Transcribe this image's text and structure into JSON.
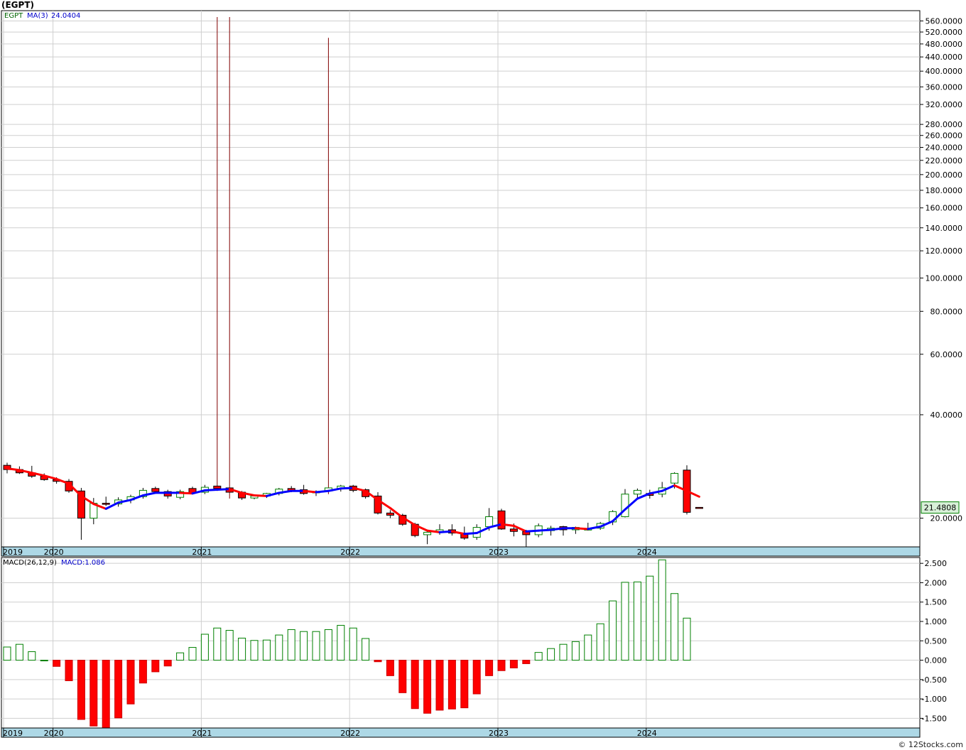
{
  "header": {
    "title": "(EGPT)"
  },
  "footer": {
    "credit": "© 12Stocks.com"
  },
  "chart_data": [
    {
      "type": "candlestick",
      "symbol": "EGPT",
      "legend": {
        "symbol_label": "EGPT",
        "ma_label": "MA(3)",
        "ma_value": "24.0404"
      },
      "last_price_label": "21.4808",
      "y_scale": "log",
      "ylim": [
        16.5,
        600
      ],
      "y_ticks": [
        {
          "v": 20,
          "label": "20.0000"
        },
        {
          "v": 40,
          "label": "40.0000"
        },
        {
          "v": 60,
          "label": "60.0000"
        },
        {
          "v": 80,
          "label": "80.0000"
        },
        {
          "v": 100,
          "label": "100.0000"
        },
        {
          "v": 120,
          "label": "120.0000"
        },
        {
          "v": 140,
          "label": "140.0000"
        },
        {
          "v": 160,
          "label": "160.0000"
        },
        {
          "v": 180,
          "label": "180.0000"
        },
        {
          "v": 200,
          "label": "200.0000"
        },
        {
          "v": 220,
          "label": "220.0000"
        },
        {
          "v": 240,
          "label": "240.0000"
        },
        {
          "v": 260,
          "label": "260.0000"
        },
        {
          "v": 280,
          "label": "280.0000"
        },
        {
          "v": 320,
          "label": "320.0000"
        },
        {
          "v": 360,
          "label": "360.0000"
        },
        {
          "v": 400,
          "label": "400.0000"
        },
        {
          "v": 440,
          "label": "440.0000"
        },
        {
          "v": 480,
          "label": "480.0000"
        },
        {
          "v": 520,
          "label": "520.0000"
        },
        {
          "v": 560,
          "label": "560.0000"
        }
      ],
      "x_start": "2019-03",
      "x_labels": [
        {
          "label": "2019",
          "index": 0
        },
        {
          "label": "2020",
          "index": 4
        },
        {
          "label": "2021",
          "index": 16
        },
        {
          "label": "2022",
          "index": 28
        },
        {
          "label": "2023",
          "index": 40
        },
        {
          "label": "2024",
          "index": 52
        }
      ],
      "ohlc": [
        [
          28.5,
          29.0,
          27.0,
          27.7
        ],
        [
          27.7,
          28.3,
          26.9,
          27.1
        ],
        [
          27.1,
          28.4,
          26.2,
          26.5
        ],
        [
          26.5,
          27.0,
          25.7,
          25.9
        ],
        [
          25.9,
          26.3,
          25.2,
          25.6
        ],
        [
          25.6,
          26.0,
          23.7,
          24.0
        ],
        [
          24.0,
          24.5,
          17.3,
          20.0
        ],
        [
          20.0,
          22.9,
          19.2,
          22.1
        ],
        [
          22.1,
          23.1,
          21.7,
          22.0
        ],
        [
          22.0,
          23.0,
          21.6,
          22.6
        ],
        [
          22.6,
          23.4,
          22.1,
          23.1
        ],
        [
          23.1,
          24.5,
          22.8,
          24.1
        ],
        [
          24.4,
          24.7,
          23.8,
          23.9
        ],
        [
          23.9,
          24.2,
          22.8,
          23.2
        ],
        [
          23.0,
          24.2,
          22.7,
          23.9
        ],
        [
          24.4,
          24.7,
          23.6,
          23.7
        ],
        [
          23.8,
          25.0,
          23.5,
          24.6
        ],
        [
          24.8,
          575,
          24.0,
          24.4
        ],
        [
          24.5,
          575,
          22.8,
          23.8
        ],
        [
          23.8,
          24.0,
          22.6,
          22.9
        ],
        [
          22.9,
          23.4,
          22.7,
          23.2
        ],
        [
          23.2,
          23.7,
          22.9,
          23.6
        ],
        [
          23.6,
          24.5,
          23.3,
          24.3
        ],
        [
          24.4,
          24.8,
          23.8,
          24.0
        ],
        [
          24.2,
          25.0,
          23.4,
          23.6
        ],
        [
          23.7,
          24.1,
          23.2,
          23.9
        ],
        [
          24.0,
          500,
          23.5,
          24.5
        ],
        [
          24.4,
          25.0,
          23.9,
          24.8
        ],
        [
          24.8,
          25.0,
          23.8,
          24.1
        ],
        [
          24.2,
          24.4,
          22.8,
          23.1
        ],
        [
          23.2,
          23.8,
          20.5,
          20.7
        ],
        [
          20.7,
          21.1,
          20.0,
          20.4
        ],
        [
          20.4,
          20.6,
          19.0,
          19.2
        ],
        [
          19.2,
          19.4,
          17.6,
          17.8
        ],
        [
          17.9,
          18.5,
          16.8,
          18.2
        ],
        [
          18.2,
          19.2,
          17.9,
          18.5
        ],
        [
          18.5,
          19.2,
          17.8,
          18.1
        ],
        [
          18.1,
          18.9,
          17.3,
          17.5
        ],
        [
          17.6,
          19.2,
          17.3,
          18.8
        ],
        [
          18.9,
          21.4,
          18.4,
          20.2
        ],
        [
          21.0,
          21.3,
          18.5,
          18.6
        ],
        [
          18.6,
          19.3,
          17.7,
          18.3
        ],
        [
          18.3,
          18.5,
          16.5,
          17.9
        ],
        [
          17.9,
          19.3,
          17.6,
          19.0
        ],
        [
          18.4,
          19.0,
          17.8,
          18.7
        ],
        [
          18.9,
          19.0,
          17.8,
          18.5
        ],
        [
          18.5,
          18.9,
          18.0,
          18.8
        ],
        [
          18.6,
          19.4,
          18.4,
          18.6
        ],
        [
          18.7,
          19.5,
          18.5,
          19.3
        ],
        [
          19.5,
          21.1,
          19.1,
          20.9
        ],
        [
          20.2,
          24.3,
          20.1,
          23.5
        ],
        [
          23.5,
          24.4,
          22.9,
          24.1
        ],
        [
          23.6,
          24.2,
          22.8,
          23.3
        ],
        [
          23.5,
          25.5,
          23.0,
          24.5
        ],
        [
          25.3,
          27.2,
          24.4,
          27.0
        ],
        [
          27.6,
          28.5,
          20.5,
          20.8
        ],
        [
          21.5,
          21.5,
          21.4,
          21.48
        ]
      ],
      "ma": [
        27.9,
        27.6,
        27.1,
        26.6,
        26.0,
        25.2,
        23.2,
        22.0,
        21.3,
        22.2,
        22.6,
        23.3,
        23.7,
        23.7,
        23.7,
        23.6,
        24.1,
        24.2,
        24.3,
        23.7,
        23.3,
        23.2,
        23.7,
        24.0,
        24.0,
        23.8,
        24.0,
        24.4,
        24.5,
        24.0,
        22.6,
        21.4,
        20.1,
        19.1,
        18.4,
        18.2,
        18.3,
        18.0,
        18.1,
        18.8,
        19.2,
        19.0,
        18.3,
        18.4,
        18.5,
        18.7,
        18.7,
        18.6,
        18.9,
        19.6,
        21.2,
        22.8,
        23.6,
        24.0,
        24.9,
        24.0,
        23.1
      ]
    },
    {
      "type": "bar",
      "legend": {
        "indicator_label": "MACD(26,12,9)",
        "value_label": "MACD:1.086"
      },
      "ylim": [
        -1.75,
        2.65
      ],
      "y_ticks": [
        {
          "v": 2.5,
          "label": "2.500"
        },
        {
          "v": 2.0,
          "label": "2.000"
        },
        {
          "v": 1.5,
          "label": "1.500"
        },
        {
          "v": 1.0,
          "label": "1.000"
        },
        {
          "v": 0.5,
          "label": "0.500"
        },
        {
          "v": 0.0,
          "label": "0.000"
        },
        {
          "v": -0.5,
          "label": "-0.500"
        },
        {
          "v": -1.0,
          "label": "-1.000"
        },
        {
          "v": -1.5,
          "label": "-1.500"
        }
      ],
      "x_labels": [
        {
          "label": "2019",
          "index": 0
        },
        {
          "label": "2020",
          "index": 4
        },
        {
          "label": "2021",
          "index": 16
        },
        {
          "label": "2022",
          "index": 28
        },
        {
          "label": "2023",
          "index": 40
        },
        {
          "label": "2024",
          "index": 52
        }
      ],
      "values": [
        0.34,
        0.41,
        0.22,
        0.0,
        -0.16,
        -0.53,
        -1.53,
        -1.7,
        -1.77,
        -1.49,
        -1.13,
        -0.59,
        -0.3,
        -0.15,
        0.19,
        0.33,
        0.67,
        0.83,
        0.77,
        0.57,
        0.51,
        0.52,
        0.65,
        0.79,
        0.74,
        0.74,
        0.79,
        0.9,
        0.83,
        0.56,
        -0.04,
        -0.4,
        -0.84,
        -1.25,
        -1.37,
        -1.29,
        -1.26,
        -1.23,
        -0.87,
        -0.4,
        -0.27,
        -0.2,
        -0.09,
        0.2,
        0.3,
        0.41,
        0.48,
        0.65,
        0.94,
        1.53,
        2.01,
        2.02,
        2.17,
        2.59,
        1.72,
        1.086
      ]
    }
  ],
  "colors": {
    "up": "#008000",
    "down": "#ff0000",
    "ma_up": "#0000ff",
    "ma_down": "#ff0000",
    "grid": "#cfcfcf",
    "axis_band": "#add8e6",
    "price_box": "#d8f0d8"
  }
}
